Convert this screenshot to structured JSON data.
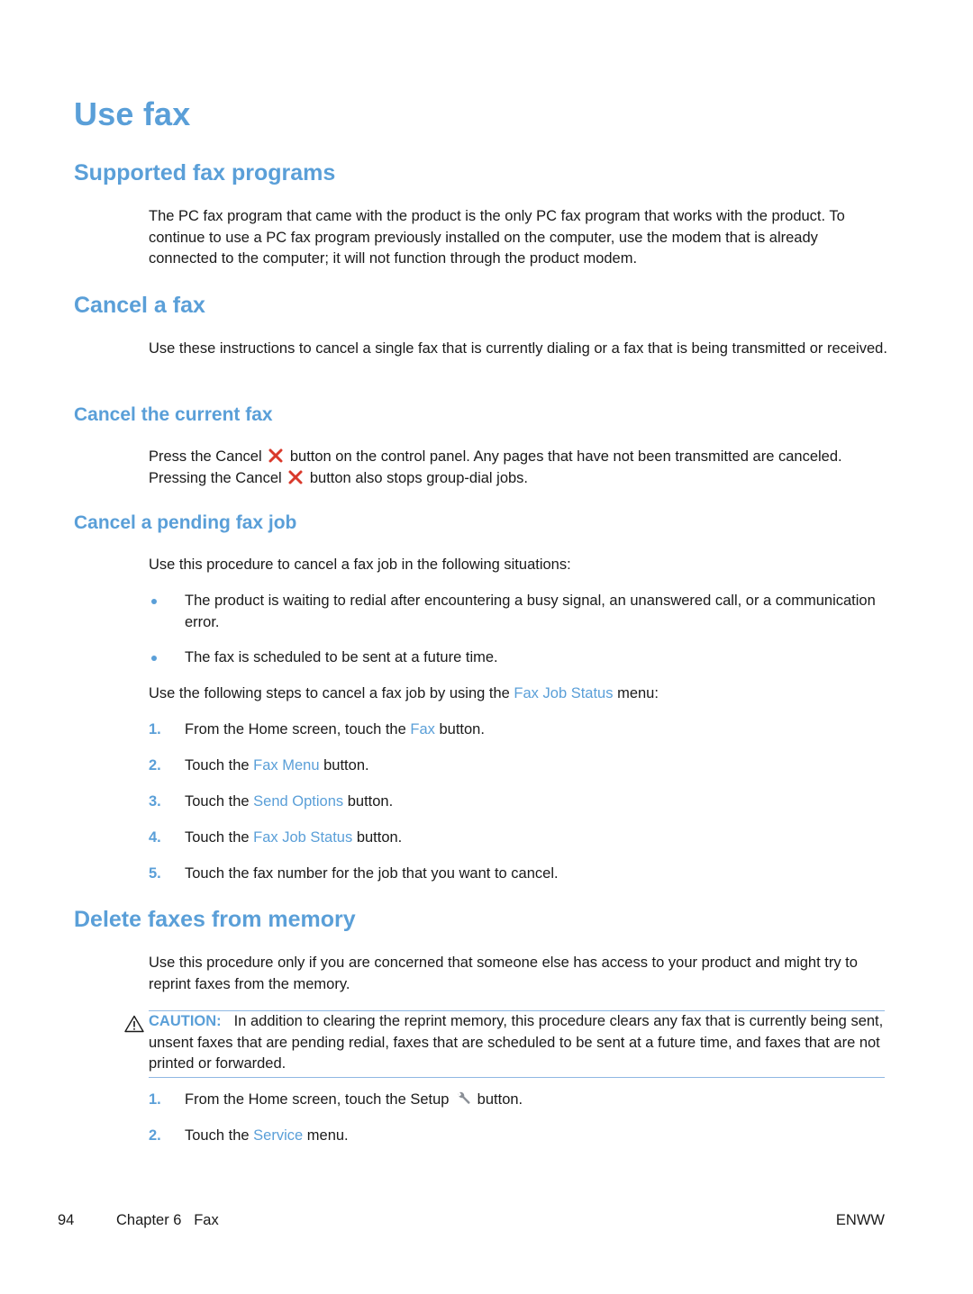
{
  "page": {
    "title": "Use fax",
    "colors": {
      "accent": "#5a9fd8",
      "cancel_icon": "#d9392b",
      "text": "#1a1a1a"
    }
  },
  "sections": {
    "supported": {
      "heading": "Supported fax programs",
      "body": "The PC fax program that came with the product is the only PC fax program that works with the product. To continue to use a PC fax program previously installed on the computer, use the modem that is already connected to the computer; it will not function through the product modem."
    },
    "cancel": {
      "heading": "Cancel a fax",
      "body": "Use these instructions to cancel a single fax that is currently dialing or a fax that is being transmitted or received."
    },
    "cancel_current": {
      "heading": "Cancel the current fax",
      "body_part1": "Press the Cancel",
      "body_part2": "button on the control panel. Any pages that have not been transmitted are canceled. Pressing the Cancel",
      "body_part3": "button also stops group-dial jobs.",
      "icon": "cancel-x-icon"
    },
    "cancel_pending": {
      "heading": "Cancel a pending fax job",
      "intro": "Use this procedure to cancel a fax job in the following situations:",
      "bullets": [
        "The product is waiting to redial after encountering a busy signal, an unanswered call, or a communication error.",
        "The fax is scheduled to be sent at a future time."
      ],
      "steps_intro": {
        "pre": "Use the following steps to cancel a fax job by using the",
        "link": "Fax Job Status",
        "post": "menu:"
      },
      "steps": [
        {
          "num": "1.",
          "pre": "From the Home screen, touch the",
          "link": "Fax",
          "post": "button."
        },
        {
          "num": "2.",
          "pre": "Touch the",
          "link": "Fax Menu",
          "post": "button."
        },
        {
          "num": "3.",
          "pre": "Touch the",
          "link": "Send Options",
          "post": "button."
        },
        {
          "num": "4.",
          "pre": "Touch the",
          "link": "Fax Job Status",
          "post": "button."
        },
        {
          "num": "5.",
          "pre": "Touch the fax number for the job that you want to cancel.",
          "link": "",
          "post": ""
        }
      ]
    },
    "delete": {
      "heading": "Delete faxes from memory",
      "body": "Use this procedure only if you are concerned that someone else has access to your product and might try to reprint faxes from the memory.",
      "caution_label": "CAUTION:",
      "caution_text": "In addition to clearing the reprint memory, this procedure clears any fax that is currently being sent, unsent faxes that are pending redial, faxes that are scheduled to be sent at a future time, and faxes that are not printed or forwarded.",
      "steps": [
        {
          "num": "1.",
          "pre": "From the Home screen, touch the Setup",
          "link": "",
          "post": "button.",
          "icon": "wrench-icon"
        },
        {
          "num": "2.",
          "pre": "Touch the",
          "link": "Service",
          "post": "menu."
        }
      ]
    }
  },
  "footer": {
    "page_number": "94",
    "chapter": "Chapter 6   Fax",
    "locale_code": "ENWW"
  }
}
